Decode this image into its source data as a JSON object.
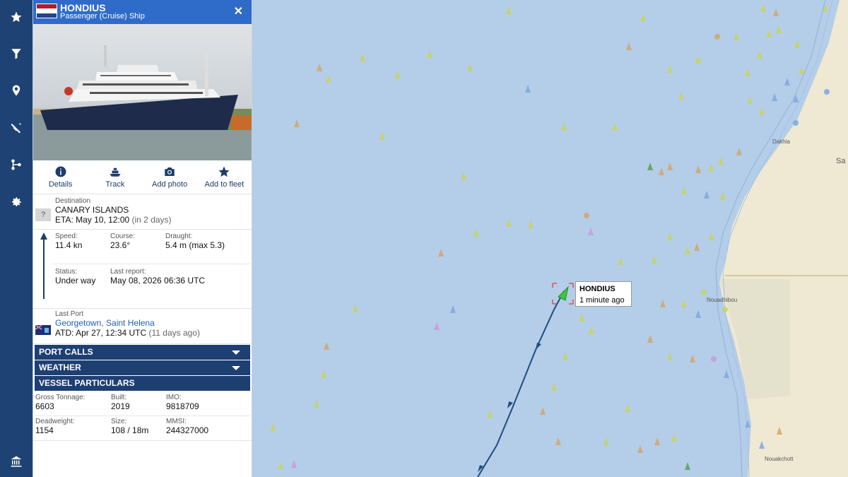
{
  "vessel": {
    "name": "HONDIUS",
    "type": "Passenger (Cruise) Ship",
    "flag_colors": [
      "#ae1c28",
      "#ffffff",
      "#21468b"
    ]
  },
  "actions": [
    {
      "label": "Details",
      "icon": "info-icon"
    },
    {
      "label": "Track",
      "icon": "ship-track-icon"
    },
    {
      "label": "Add photo",
      "icon": "camera-icon"
    },
    {
      "label": "Add to fleet",
      "icon": "star-icon"
    }
  ],
  "destination": {
    "label": "Destination",
    "unknown_flag": "?",
    "name": "CANARY ISLANDS",
    "eta": "ETA: May 10, 12:00",
    "eta_note": "(in 2 days)"
  },
  "stats": {
    "speed_label": "Speed:",
    "speed": "11.4 kn",
    "course_label": "Course:",
    "course": "23.6°",
    "draught_label": "Draught:",
    "draught": "5.4 m",
    "draught_note": "(max 5.3)",
    "status_label": "Status:",
    "status": "Under way",
    "last_report_label": "Last report:",
    "last_report": "May 08, 2026 06:36 UTC"
  },
  "last_port": {
    "label": "Last Port",
    "name": "Georgetown, Saint Helena",
    "atd": "ATD: Apr 27, 12:34 UTC",
    "atd_note": "(11 days ago)"
  },
  "sections": {
    "port_calls": "PORT CALLS",
    "weather": "WEATHER",
    "particulars": "VESSEL PARTICULARS"
  },
  "particulars": {
    "gross_tonnage_label": "Gross Tonnage:",
    "gross_tonnage": "6603",
    "built_label": "Built:",
    "built": "2019",
    "imo_label": "IMO:",
    "imo": "9818709",
    "deadweight_label": "Deadweight:",
    "deadweight": "1154",
    "size_label": "Size:",
    "size": "108 / 18m",
    "mmsi_label": "MMSI:",
    "mmsi": "244327000"
  },
  "map": {
    "tooltip_name": "HONDIUS",
    "tooltip_time": "1 minute ago",
    "places": [
      "Dakhla",
      "Sa",
      "Nouadhibou",
      "Nouakchott"
    ],
    "colors": {
      "sea": "#b4cde8",
      "land": "#efe8d3",
      "track": "#1d4e80",
      "selected": "#3ac83a"
    }
  },
  "rail_icons": [
    "star-icon",
    "filter-icon",
    "location-pin-icon",
    "satellite-icon",
    "route-icon",
    "settings-icon",
    "port-building-icon"
  ]
}
